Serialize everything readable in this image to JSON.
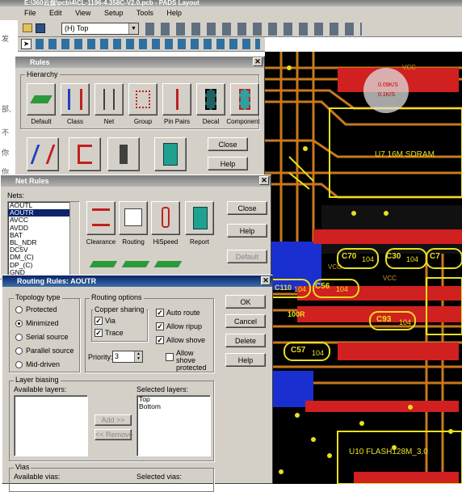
{
  "app": {
    "title": "E:\\360云盘\\pcb\\4\\CL-1196-4.358C-V2.0.pcb - PADS Layout"
  },
  "menu": [
    "File",
    "Edit",
    "View",
    "Setup",
    "Tools",
    "Help"
  ],
  "toolbar": {
    "layer_select": "(H) Top"
  },
  "canvas": {
    "labels": {
      "u7": "U7  16M SDRAM",
      "u10": "U10  FLASH128M_3.0",
      "vcc1": "VCC",
      "vcc2": "VCC",
      "vcc3": "VCC"
    },
    "parts": [
      "C70",
      "104",
      "C30",
      "104",
      "C7",
      "C110",
      "104",
      "C56",
      "104",
      "C93",
      "104",
      "C57",
      "104",
      "100R"
    ],
    "net_overlay": {
      "line1": "0.09K/S",
      "line2": "0.1K/S"
    }
  },
  "left_fragments": [
    "发",
    "部,",
    "不",
    "你",
    "你"
  ],
  "rules": {
    "title": "Rules",
    "hierarchy_label": "Hierarchy",
    "items": [
      "Default",
      "Class",
      "Net",
      "Group",
      "Pin Pairs",
      "Decal",
      "Component"
    ],
    "close": "Close",
    "help": "Help"
  },
  "net_rules": {
    "title": "Net Rules",
    "nets_label": "Nets:",
    "nets": [
      "AOUTL",
      "AOUTR",
      "AVCC",
      "AVDD",
      "BAT",
      "BL_NDR",
      "DC5V",
      "DM_(C)",
      "DP_(C)",
      "GND"
    ],
    "selected_net": "AOUTR",
    "buttons": [
      "Clearance",
      "Routing",
      "HiSpeed",
      "Report"
    ],
    "close": "Close",
    "help": "Help",
    "default": "Default"
  },
  "routing": {
    "title": "Routing Rules: AOUTR",
    "topology_label": "Topology type",
    "topology": [
      "Protected",
      "Minimized",
      "Serial source",
      "Parallel source",
      "Mid-driven"
    ],
    "topology_selected": "Minimized",
    "options_label": "Routing options",
    "copper_label": "Copper sharing",
    "via": "Via",
    "trace": "Trace",
    "auto_route": "Auto route",
    "allow_ripup": "Allow ripup",
    "allow_shove": "Allow shove",
    "allow_shove_protected": "Allow shove protected",
    "priority_label": "Priority:",
    "priority": "3",
    "ok": "OK",
    "cancel": "Cancel",
    "delete": "Delete",
    "help": "Help",
    "layer_label": "Layer biasing",
    "available_layers": "Available layers:",
    "selected_layers": "Selected layers:",
    "selected": [
      "Top",
      "Bottom"
    ],
    "add": "Add >>",
    "remove": "<< Remove",
    "vias_label": "Vias",
    "available_vias": "Available vias:",
    "selected_vias": "Selected vias:"
  }
}
